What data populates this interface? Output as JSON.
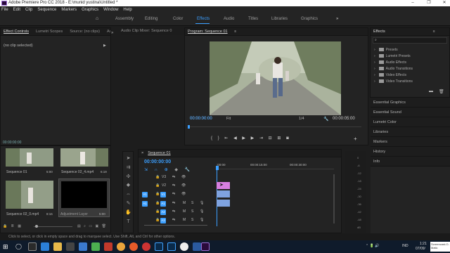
{
  "titlebar": {
    "title": "Adobe Premiere Pro CC 2018 - E:\\munid yustina\\Untitled *"
  },
  "menu": [
    "File",
    "Edit",
    "Clip",
    "Sequence",
    "Markers",
    "Graphics",
    "Window",
    "Help"
  ],
  "workspaces": [
    "Assembly",
    "Editing",
    "Color",
    "Effects",
    "Audio",
    "Titles",
    "Libraries",
    "Graphics"
  ],
  "active_workspace": "Effects",
  "source_panel": {
    "tabs": [
      "Effect Controls",
      "Lumetri Scopes",
      "Source: (no clips)",
      "Audio Clip Mixer: Sequence 0"
    ],
    "content": "(no clip selected)",
    "timecode": "00:00:00:00"
  },
  "program": {
    "tab": "Program: Sequence 01",
    "timecode": "00:00:00:00",
    "fit": "Fit",
    "ratio": "1/4",
    "duration": "00:00:05:00"
  },
  "project": {
    "items": [
      {
        "name": "Sequence 01",
        "dur": "5:00"
      },
      {
        "name": "Sequence 02_4.mp4",
        "dur": "6:19"
      },
      {
        "name": "Sequence 02_0.mp4",
        "dur": "8:16"
      },
      {
        "name": "Adjustment Layer",
        "dur": "5:00"
      }
    ]
  },
  "timeline": {
    "tab": "Sequence 01",
    "timecode": "00:00:00:00",
    "ruler": [
      ":00:00",
      "00:00:15:00",
      "00:00:30:00"
    ],
    "video_tracks": [
      "V3",
      "V2",
      "V1"
    ],
    "audio_tracks": [
      "A1",
      "A2",
      "A3"
    ]
  },
  "effects": {
    "title": "Effects",
    "search_placeholder": "",
    "folders": [
      "Presets",
      "Lumetri Presets",
      "Audio Effects",
      "Audio Transitions",
      "Video Effects",
      "Video Transitions"
    ]
  },
  "right_panels": [
    "Essential Graphics",
    "Essential Sound",
    "Lumetri Color",
    "Libraries",
    "Markers",
    "History",
    "Info"
  ],
  "meter_labels": [
    "0",
    "-6",
    "-12",
    "-18",
    "-24",
    "-30",
    "-36",
    "-42",
    "-48",
    "dB"
  ],
  "status": "Click to select, or click in empty space and drag to marquee select. Use Shift, Alt, and Ctrl for other options.",
  "taskbar": {
    "time": "1:21",
    "date": "07/09/",
    "lang": "IND",
    "screencast": "Screencast-O-Matic"
  },
  "colors": {
    "accent": "#3b9fff",
    "clip_pink": "#d77fe0",
    "clip_blue": "#7fa3e0",
    "panel": "#232323"
  }
}
